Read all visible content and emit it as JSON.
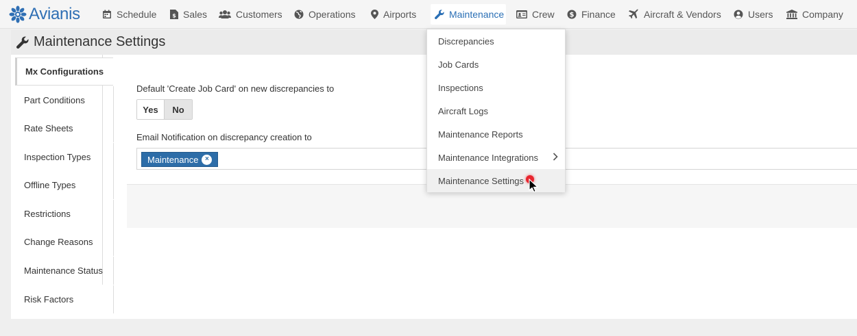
{
  "brand": {
    "name": "Avianis",
    "color": "#2f6fb4"
  },
  "nav": {
    "items": [
      {
        "label": "Schedule",
        "icon": "calendar-icon"
      },
      {
        "label": "Sales",
        "icon": "document-dollar-icon"
      },
      {
        "label": "Customers",
        "icon": "users-icon"
      },
      {
        "label": "Operations",
        "icon": "globe-icon"
      },
      {
        "label": "Airports",
        "icon": "map-pin-icon"
      },
      {
        "label": "Maintenance",
        "icon": "wrench-icon",
        "active": true
      },
      {
        "label": "Crew",
        "icon": "id-card-icon"
      },
      {
        "label": "Finance",
        "icon": "dollar-circle-icon"
      },
      {
        "label": "Aircraft & Vendors",
        "icon": "plane-icon"
      },
      {
        "label": "Users",
        "icon": "user-circle-icon"
      },
      {
        "label": "Company",
        "icon": "building-icon"
      }
    ]
  },
  "page": {
    "title": "Maintenance Settings",
    "icon": "wrench-icon"
  },
  "tabs": [
    {
      "label": "Mx Configurations",
      "active": true
    },
    {
      "label": "Part Conditions"
    },
    {
      "label": "Rate Sheets"
    },
    {
      "label": "Inspection Types"
    },
    {
      "label": "Offline Types"
    },
    {
      "label": "Restrictions"
    },
    {
      "label": "Change Reasons"
    },
    {
      "label": "Maintenance Status"
    },
    {
      "label": "Risk Factors"
    }
  ],
  "settings": {
    "job_card_label": "Default 'Create Job Card' on new discrepancies to",
    "yes_label": "Yes",
    "no_label": "No",
    "selected": "No",
    "email_label": "Email Notification on discrepancy creation to",
    "email_tags": [
      "Maintenance"
    ],
    "tag_remove": "×"
  },
  "dropdown": {
    "items": [
      {
        "label": "Discrepancies"
      },
      {
        "label": "Job Cards"
      },
      {
        "label": "Inspections"
      },
      {
        "label": "Aircraft Logs"
      },
      {
        "label": "Maintenance Reports"
      },
      {
        "label": "Maintenance Integrations",
        "submenu": true
      },
      {
        "label": "Maintenance Settings",
        "hover": true
      }
    ]
  },
  "colors": {
    "accent": "#2a6fb5",
    "tag": "#2d6da8",
    "cursor_dot": "#e8262f"
  }
}
